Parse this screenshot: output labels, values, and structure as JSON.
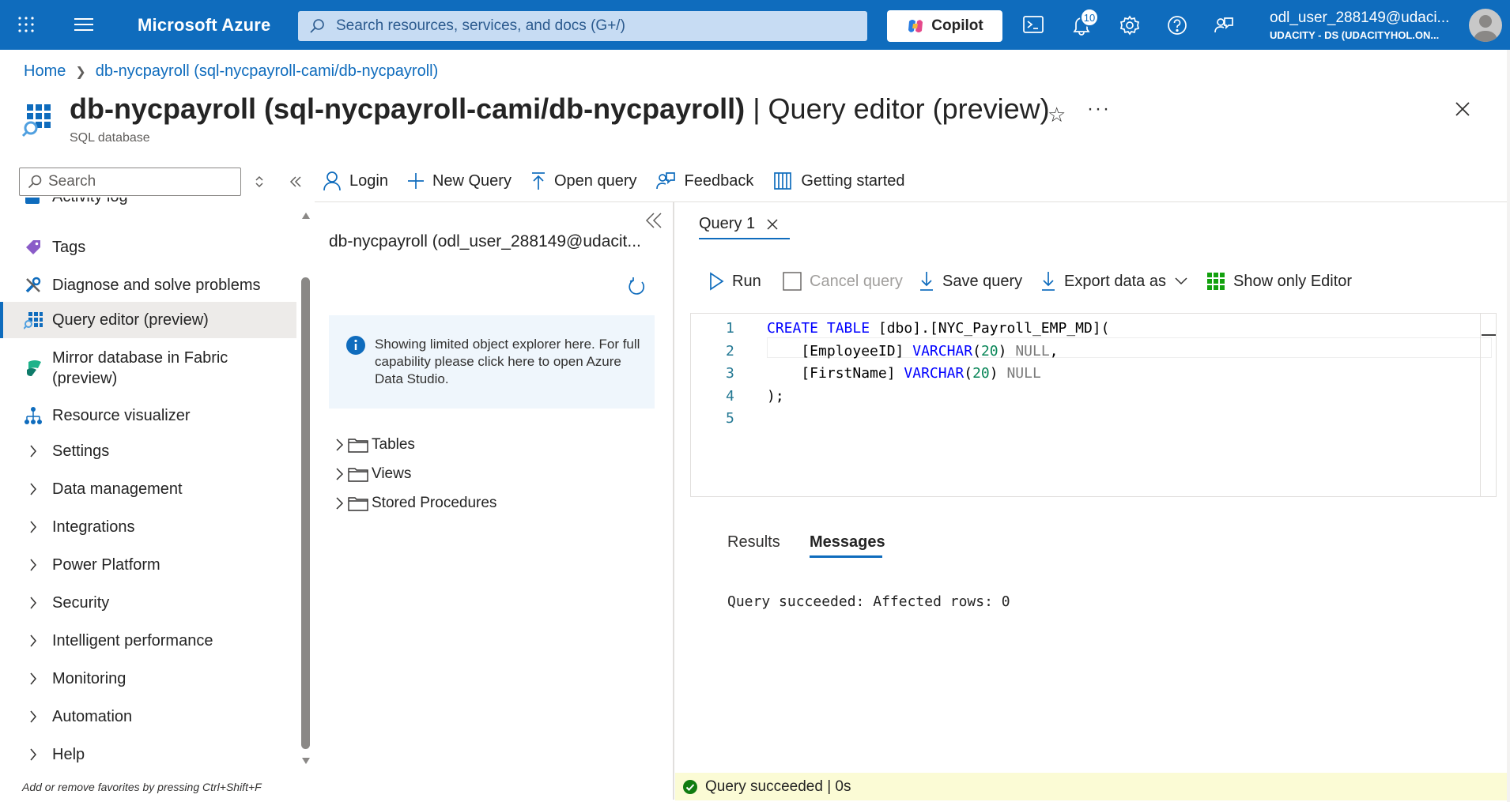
{
  "topbar": {
    "brand": "Microsoft Azure",
    "search_placeholder": "Search resources, services, and docs (G+/)",
    "copilot_label": "Copilot",
    "notifications_count": "10",
    "user_name": "odl_user_288149@udaci...",
    "user_tenant": "UDACITY - DS (UDACITYHOL.ON..."
  },
  "breadcrumb": {
    "home": "Home",
    "current": "db-nycpayroll (sql-nycpayroll-cami/db-nycpayroll)"
  },
  "header": {
    "title_bold": "db-nycpayroll (sql-nycpayroll-cami/db-nycpayroll)",
    "title_rest": " | Query editor (preview)",
    "subtitle": "SQL database"
  },
  "nav": {
    "search_placeholder": "Search",
    "items": [
      {
        "label": "Activity log",
        "icon": "activity-log-icon"
      },
      {
        "label": "Tags",
        "icon": "tag-icon"
      },
      {
        "label": "Diagnose and solve problems",
        "icon": "wrench-icon"
      },
      {
        "label": "Query editor (preview)",
        "icon": "query-editor-icon"
      },
      {
        "label": "Mirror database in Fabric",
        "label2": "(preview)",
        "icon": "fabric-icon"
      },
      {
        "label": "Resource visualizer",
        "icon": "resource-visualizer-icon"
      },
      {
        "label": "Settings"
      },
      {
        "label": "Data management"
      },
      {
        "label": "Integrations"
      },
      {
        "label": "Power Platform"
      },
      {
        "label": "Security"
      },
      {
        "label": "Intelligent performance"
      },
      {
        "label": "Monitoring"
      },
      {
        "label": "Automation"
      },
      {
        "label": "Help"
      }
    ],
    "hint": "Add or remove favorites by pressing Ctrl+Shift+F"
  },
  "toolbar": {
    "login": "Login",
    "new_query": "New Query",
    "open_query": "Open query",
    "feedback": "Feedback",
    "getting_started": "Getting started"
  },
  "explorer": {
    "connection": "db-nycpayroll (odl_user_288149@udacit...",
    "info": "Showing limited object explorer here. For full capability please click here to open Azure Data Studio.",
    "tree": [
      "Tables",
      "Views",
      "Stored Procedures"
    ]
  },
  "editor": {
    "tab_label": "Query 1",
    "run": "Run",
    "cancel": "Cancel query",
    "save": "Save query",
    "export": "Export data as",
    "show_only_editor": "Show only Editor",
    "line_numbers": [
      "1",
      "2",
      "3",
      "4",
      "5"
    ],
    "code": {
      "l1_kw": "CREATE TABLE",
      "l1_rest": " [dbo].[NYC_Payroll_EMP_MD](",
      "l2_col": "    [EmployeeID] ",
      "l2_type": "VARCHAR",
      "l2_p1": "(",
      "l2_num": "20",
      "l2_p2": ") ",
      "l2_null": "NULL",
      "l2_end": ",",
      "l3_col": "    [FirstName] ",
      "l3_type": "VARCHAR",
      "l3_p1": "(",
      "l3_num": "20",
      "l3_p2": ") ",
      "l3_null": "NULL",
      "l4": ");"
    }
  },
  "results": {
    "tab_results": "Results",
    "tab_messages": "Messages",
    "message": "Query succeeded: Affected rows: 0"
  },
  "status": {
    "text": "Query succeeded | 0s",
    "color": "#107c10"
  }
}
